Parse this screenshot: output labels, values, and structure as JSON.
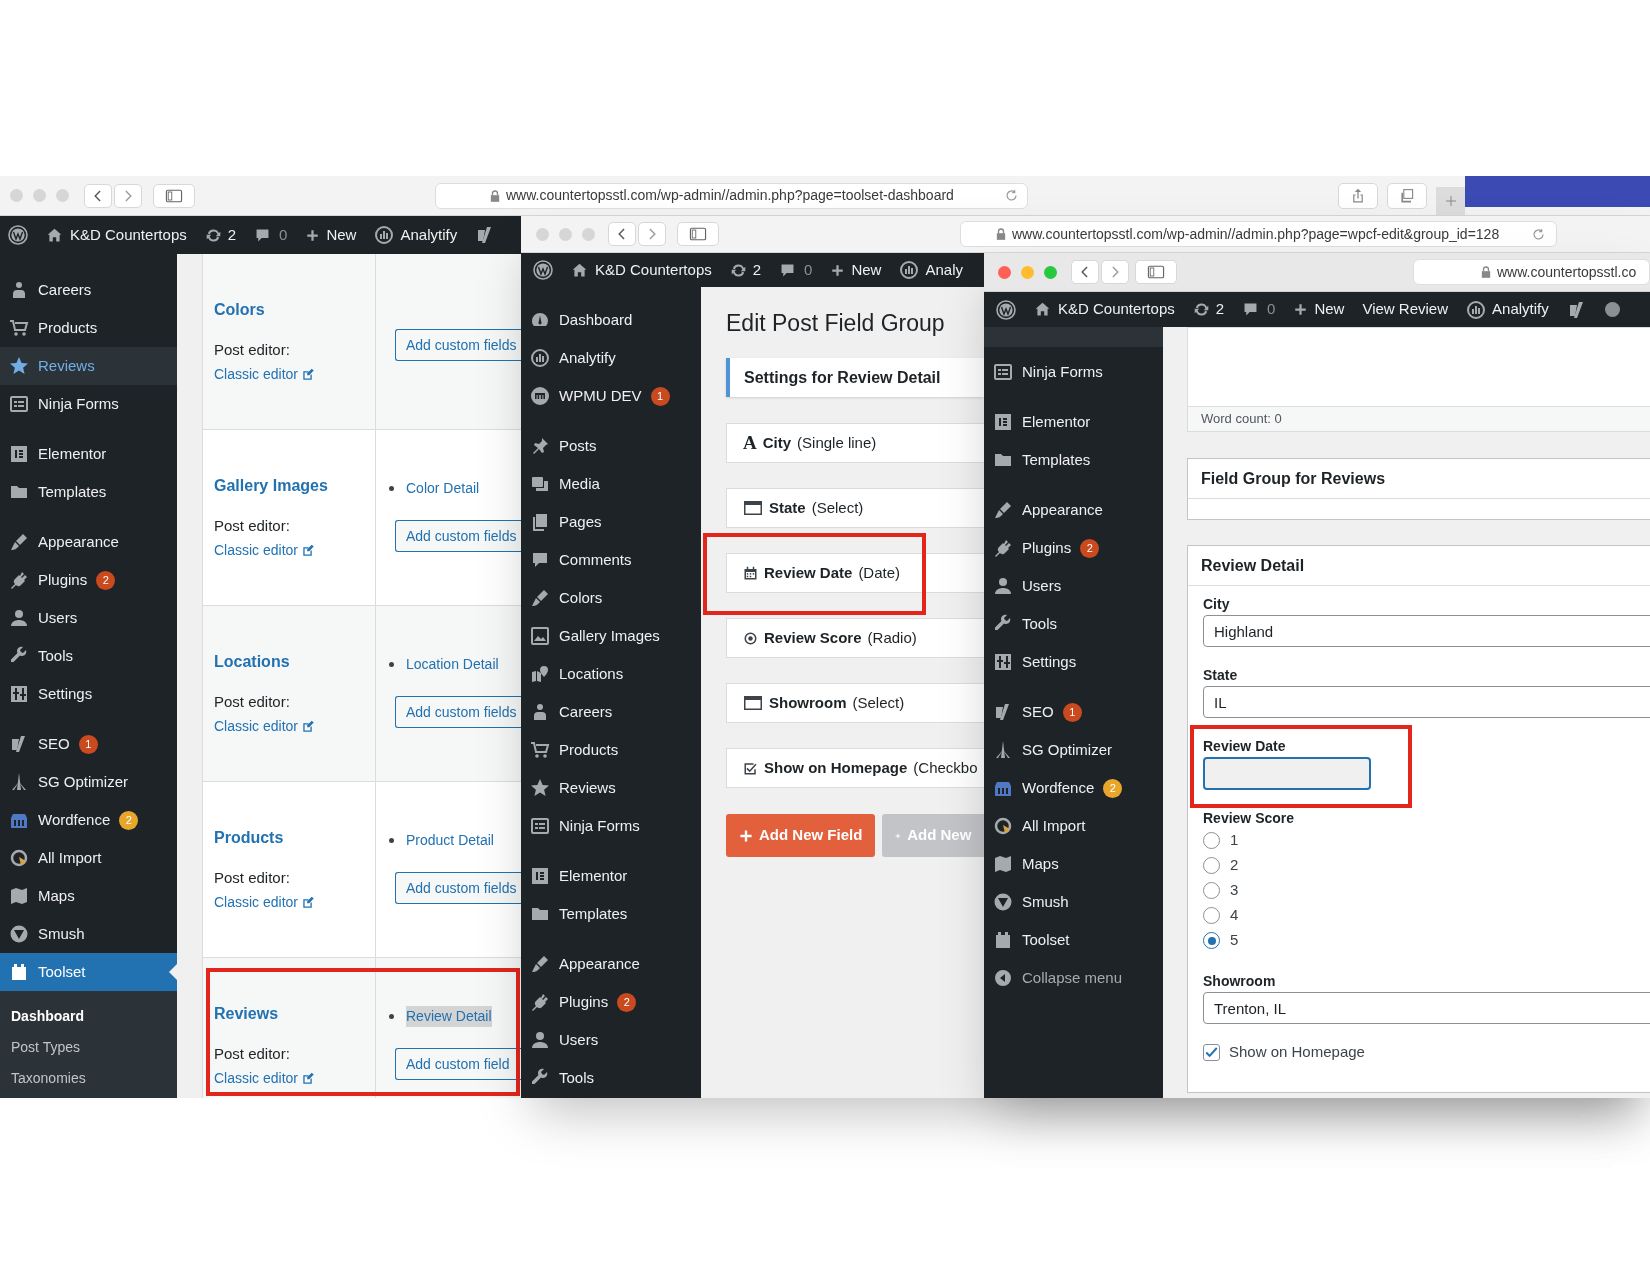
{
  "windows": [
    {
      "kind": "post-types",
      "active": false,
      "url": "www.countertopsstl.com/wp-admin//admin.php?page=toolset-dashboard",
      "admin_bar": {
        "site": "K&D Countertops",
        "updates": "2",
        "comments": "0",
        "new": "New",
        "links": [
          {
            "kind": "analytics",
            "label": "Analytify"
          },
          {
            "kind": "seo"
          }
        ]
      },
      "menu": [
        {
          "kind": "careers",
          "label": "Careers",
          "selected": false,
          "hovered": false
        },
        {
          "kind": "products",
          "label": "Products",
          "selected": false,
          "hovered": false
        },
        {
          "kind": "reviews",
          "label": "Reviews",
          "selected": false,
          "hovered": true
        },
        {
          "kind": "forms",
          "label": "Ninja Forms",
          "selected": false,
          "hovered": false
        },
        {
          "kind": "separator"
        },
        {
          "kind": "elementor",
          "label": "Elementor",
          "selected": false,
          "hovered": false
        },
        {
          "kind": "templates",
          "label": "Templates",
          "selected": false,
          "hovered": false
        },
        {
          "kind": "separator"
        },
        {
          "kind": "appearance",
          "label": "Appearance",
          "selected": false,
          "hovered": false
        },
        {
          "kind": "plugins",
          "label": "Plugins",
          "badge": {
            "text": "2",
            "color": "#ca4a1f"
          },
          "selected": false,
          "hovered": false
        },
        {
          "kind": "users",
          "label": "Users",
          "selected": false,
          "hovered": false
        },
        {
          "kind": "tools",
          "label": "Tools",
          "selected": false,
          "hovered": false
        },
        {
          "kind": "settings",
          "label": "Settings",
          "selected": false,
          "hovered": false
        },
        {
          "kind": "separator"
        },
        {
          "kind": "seo",
          "label": "SEO",
          "badge": {
            "text": "1",
            "color": "#ca4a1f"
          },
          "selected": false,
          "hovered": false
        },
        {
          "kind": "optimizer",
          "label": "SG Optimizer",
          "selected": false,
          "hovered": false
        },
        {
          "kind": "wordfence",
          "label": "Wordfence",
          "badge": {
            "text": "2",
            "color": "#e8a72a"
          },
          "selected": false,
          "hovered": false
        },
        {
          "kind": "import",
          "label": "All Import",
          "selected": false,
          "hovered": false
        },
        {
          "kind": "maps",
          "label": "Maps",
          "selected": false,
          "hovered": false
        },
        {
          "kind": "smush",
          "label": "Smush",
          "selected": false,
          "hovered": false
        },
        {
          "kind": "toolset",
          "label": "Toolset",
          "selected": true,
          "hovered": false
        }
      ],
      "submenu": [
        {
          "label": "Dashboard",
          "selected": true
        },
        {
          "label": "Post Types",
          "selected": false
        },
        {
          "label": "Taxonomies",
          "selected": false
        }
      ],
      "post_types": [
        {
          "title": "Colors",
          "editor_label": "Post editor:",
          "editor_link": "Classic editor",
          "button": "Add custom fields",
          "highlighted": false
        },
        {
          "title": "Gallery Images",
          "editor_label": "Post editor:",
          "editor_link": "Classic editor",
          "groups": [
            {
              "label": "Color Detail",
              "selected": false
            }
          ],
          "button": "Add custom fields",
          "highlighted": false
        },
        {
          "title": "Locations",
          "editor_label": "Post editor:",
          "editor_link": "Classic editor",
          "groups": [
            {
              "label": "Location Detail",
              "selected": false
            }
          ],
          "button": "Add custom fields",
          "highlighted": false
        },
        {
          "title": "Products",
          "editor_label": "Post editor:",
          "editor_link": "Classic editor",
          "groups": [
            {
              "label": "Product Detail",
              "selected": false
            }
          ],
          "button": "Add custom fields",
          "highlighted": false
        },
        {
          "title": "Reviews",
          "editor_label": "Post editor:",
          "editor_link": "Classic editor",
          "groups": [
            {
              "label": "Review Detail",
              "selected": true
            }
          ],
          "button": "Add custom field",
          "highlighted": true
        }
      ]
    },
    {
      "kind": "field-group",
      "active": false,
      "url": "www.countertopsstl.com/wp-admin//admin.php?page=wpcf-edit&group_id=128",
      "admin_bar": {
        "site": "K&D Countertops",
        "updates": "2",
        "comments": "0",
        "new": "New",
        "links": [
          {
            "kind": "analytics",
            "label": "Analy"
          }
        ]
      },
      "menu": [
        {
          "kind": "dashboard",
          "label": "Dashboard"
        },
        {
          "kind": "analytics",
          "label": "Analytify"
        },
        {
          "kind": "wpmu",
          "label": "WPMU DEV",
          "badge": {
            "text": "1",
            "color": "#ca4a1f"
          }
        },
        {
          "kind": "separator"
        },
        {
          "kind": "posts",
          "label": "Posts"
        },
        {
          "kind": "media",
          "label": "Media"
        },
        {
          "kind": "pages",
          "label": "Pages"
        },
        {
          "kind": "comments",
          "label": "Comments"
        },
        {
          "kind": "colors",
          "label": "Colors"
        },
        {
          "kind": "gallery",
          "label": "Gallery Images"
        },
        {
          "kind": "locations",
          "label": "Locations"
        },
        {
          "kind": "careers",
          "label": "Careers"
        },
        {
          "kind": "products",
          "label": "Products"
        },
        {
          "kind": "reviews",
          "label": "Reviews"
        },
        {
          "kind": "forms",
          "label": "Ninja Forms"
        },
        {
          "kind": "separator"
        },
        {
          "kind": "elementor",
          "label": "Elementor"
        },
        {
          "kind": "templates",
          "label": "Templates"
        },
        {
          "kind": "separator"
        },
        {
          "kind": "appearance",
          "label": "Appearance"
        },
        {
          "kind": "plugins",
          "label": "Plugins",
          "badge": {
            "text": "2",
            "color": "#ca4a1f"
          }
        },
        {
          "kind": "users",
          "label": "Users"
        },
        {
          "kind": "tools",
          "label": "Tools"
        }
      ],
      "heading": "Edit Post Field Group",
      "settings_title": "Settings for Review Detail",
      "fields": [
        {
          "kind": "text",
          "glyph": "A",
          "name": "City",
          "type": "(Single line)",
          "highlighted": false
        },
        {
          "kind": "select",
          "name": "State",
          "type": "(Select)",
          "highlighted": false
        },
        {
          "kind": "date",
          "name": "Review Date",
          "type": "(Date)",
          "highlighted": true
        },
        {
          "kind": "radio",
          "name": "Review Score",
          "type": "(Radio)",
          "highlighted": false
        },
        {
          "kind": "select",
          "name": "Showroom",
          "type": "(Select)",
          "highlighted": false
        },
        {
          "kind": "checkbox",
          "name": "Show on Homepage",
          "type": "(Checkbo",
          "highlighted": false
        }
      ],
      "buttons": [
        {
          "kind": "primary",
          "label": "Add New Field"
        },
        {
          "kind": "disabled",
          "label": "Add New"
        }
      ]
    },
    {
      "kind": "post-editor",
      "active": true,
      "url": "www.countertopsstl.co",
      "admin_bar": {
        "site": "K&D Countertops",
        "updates": "2",
        "comments": "0",
        "new": "New",
        "links": [
          {
            "kind": "plain",
            "label": "View Review"
          },
          {
            "kind": "analytics",
            "label": "Analytify"
          },
          {
            "kind": "seo"
          },
          {
            "kind": "status"
          }
        ]
      },
      "menu": [
        {
          "kind": "forms",
          "label": "Ninja Forms"
        },
        {
          "kind": "separator"
        },
        {
          "kind": "elementor",
          "label": "Elementor"
        },
        {
          "kind": "templates",
          "label": "Templates"
        },
        {
          "kind": "separator"
        },
        {
          "kind": "appearance",
          "label": "Appearance"
        },
        {
          "kind": "plugins",
          "label": "Plugins",
          "badge": {
            "text": "2",
            "color": "#ca4a1f"
          }
        },
        {
          "kind": "users",
          "label": "Users"
        },
        {
          "kind": "tools",
          "label": "Tools"
        },
        {
          "kind": "settings",
          "label": "Settings"
        },
        {
          "kind": "separator"
        },
        {
          "kind": "seo",
          "label": "SEO",
          "badge": {
            "text": "1",
            "color": "#ca4a1f"
          }
        },
        {
          "kind": "optimizer",
          "label": "SG Optimizer"
        },
        {
          "kind": "wordfence",
          "label": "Wordfence",
          "badge": {
            "text": "2",
            "color": "#e8a72a"
          }
        },
        {
          "kind": "import",
          "label": "All Import"
        },
        {
          "kind": "maps",
          "label": "Maps"
        },
        {
          "kind": "smush",
          "label": "Smush"
        },
        {
          "kind": "toolset",
          "label": "Toolset"
        },
        {
          "kind": "collapse",
          "label": "Collapse menu"
        }
      ],
      "word_count": "Word count: 0",
      "group_title": "Field Group for Reviews",
      "detail": {
        "title": "Review Detail",
        "fields": [
          {
            "kind": "text",
            "label": "City",
            "value": "Highland",
            "focused": false,
            "highlighted": false
          },
          {
            "kind": "text",
            "label": "State",
            "value": "IL",
            "focused": false,
            "highlighted": false
          },
          {
            "kind": "date",
            "label": "Review Date",
            "focused": true,
            "highlighted": true
          },
          {
            "kind": "radio",
            "label": "Review Score",
            "highlighted": false,
            "options": [
              {
                "label": "1",
                "selected": false
              },
              {
                "label": "2",
                "selected": false
              },
              {
                "label": "3",
                "selected": false
              },
              {
                "label": "4",
                "selected": false
              },
              {
                "label": "5",
                "selected": true
              }
            ]
          },
          {
            "kind": "text",
            "label": "Showroom",
            "value": "Trenton, IL",
            "focused": false,
            "highlighted": false
          },
          {
            "kind": "checkbox",
            "label": "Show on Homepage",
            "checked": true,
            "highlighted": false
          }
        ]
      }
    }
  ]
}
